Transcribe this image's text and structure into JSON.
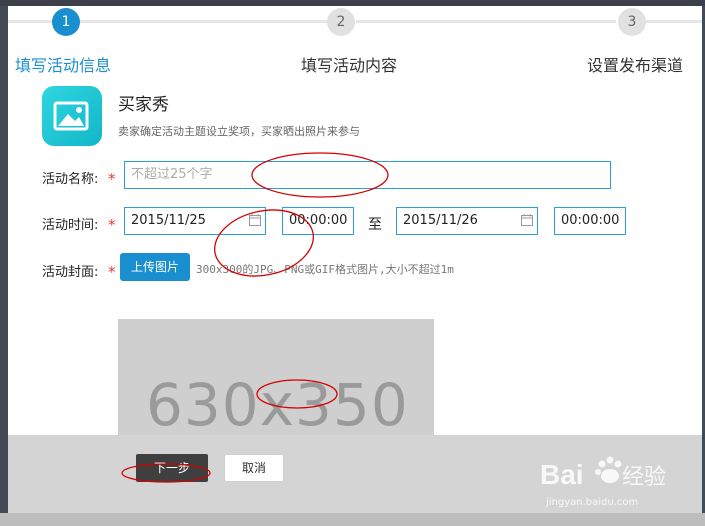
{
  "steps": [
    {
      "number": "1",
      "label": "填写活动信息",
      "active": true
    },
    {
      "number": "2",
      "label": "填写活动内容",
      "active": false
    },
    {
      "number": "3",
      "label": "设置发布渠道",
      "active": false
    }
  ],
  "app": {
    "icon": "image-icon",
    "title": "买家秀",
    "description": "卖家确定活动主题设立奖项，买家晒出照片来参与"
  },
  "form": {
    "name_label": "活动名称:",
    "name_placeholder": "不超过25个字",
    "time_label": "活动时间:",
    "start_date": "2015/11/25",
    "start_time": "00:00:00",
    "to_label": "至",
    "end_date": "2015/11/26",
    "end_time": "00:00:00",
    "cover_label": "活动封面:",
    "upload_button": "上传图片",
    "upload_hint": "300x300的JPG、PNG或GIF格式图片,大小不超过1m",
    "cover_placeholder": "630x350",
    "required_mark": "*"
  },
  "footer": {
    "next_button": "下一步",
    "cancel_button": "取消"
  },
  "watermark": {
    "url": "jingyan.baidu.com"
  },
  "colors": {
    "accent": "#1a8fd0",
    "required": "#e23b3b",
    "annotation": "#d40000"
  }
}
